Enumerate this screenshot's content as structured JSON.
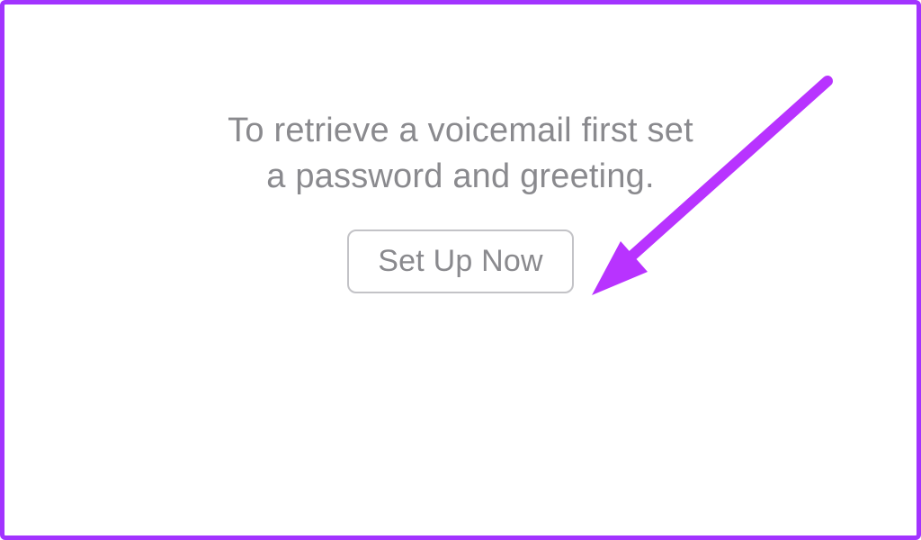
{
  "colors": {
    "frame_border": "#a233ff",
    "text_muted": "#8a8a8e",
    "button_border": "#c3c3c7",
    "arrow": "#b833ff"
  },
  "instruction_text": "To retrieve a voicemail first set a password and greeting.",
  "button_label": "Set Up Now",
  "annotation": {
    "type": "arrow",
    "points_to": "set-up-now-button"
  }
}
